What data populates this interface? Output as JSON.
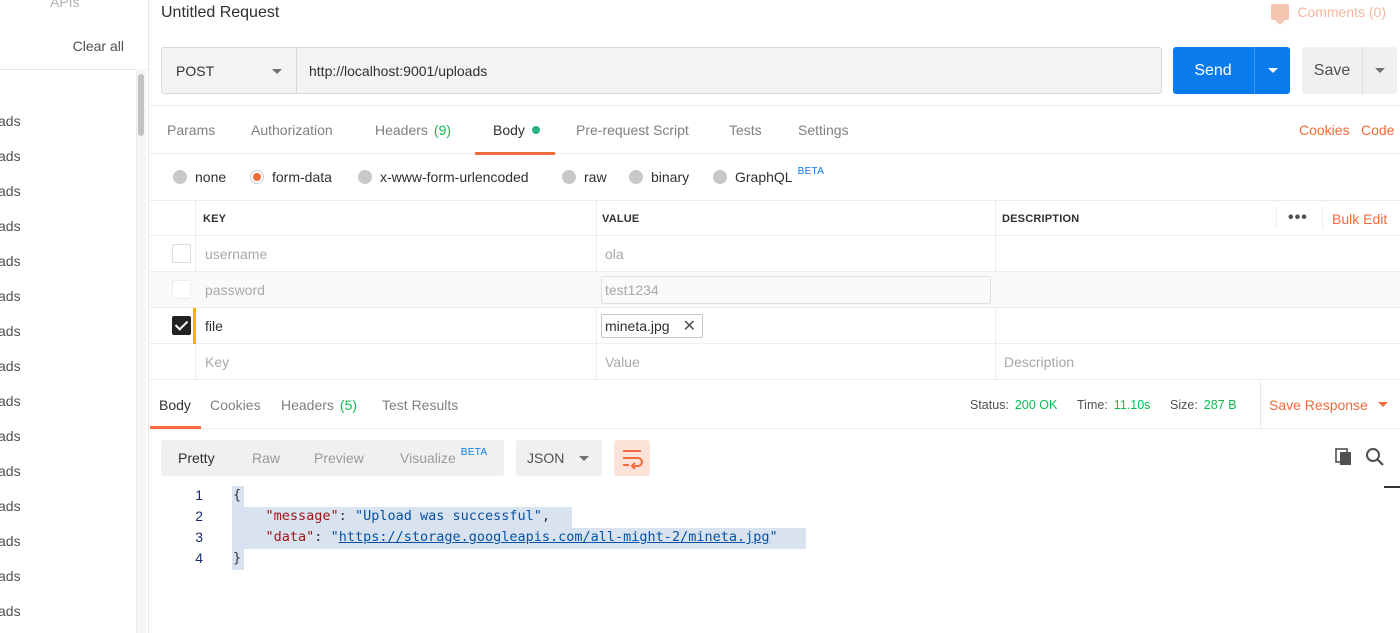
{
  "sidebar": {
    "apis_label": "APIs",
    "clear_all_label": "Clear all",
    "history_items": [
      "ads",
      "ads",
      "ads",
      "ads",
      "ads",
      "ads",
      "ads",
      "ads",
      "ads",
      "ads",
      "ads",
      "ads",
      "ads",
      "ads",
      "ads"
    ]
  },
  "request": {
    "title": "Untitled Request",
    "comments_label": "Comments (0)",
    "method": "POST",
    "url": "http://localhost:9001/uploads",
    "send_label": "Send",
    "save_label": "Save"
  },
  "request_tabs": {
    "params": "Params",
    "authorization": "Authorization",
    "headers": "Headers",
    "headers_count": "(9)",
    "body": "Body",
    "prerequest": "Pre-request Script",
    "tests": "Tests",
    "settings": "Settings",
    "cookies": "Cookies",
    "code": "Code"
  },
  "body_types": {
    "none": "none",
    "form_data": "form-data",
    "urlencoded": "x-www-form-urlencoded",
    "raw": "raw",
    "binary": "binary",
    "graphql": "GraphQL",
    "beta": "BETA",
    "selected": "form-data"
  },
  "params_table": {
    "headers": {
      "key": "KEY",
      "value": "VALUE",
      "description": "DESCRIPTION"
    },
    "more_label": "•••",
    "bulk_edit_label": "Bulk Edit",
    "rows": [
      {
        "key": "username",
        "value": "ola",
        "description": "",
        "checked": false
      },
      {
        "key": "password",
        "value": "test1234",
        "description": "",
        "checked": false
      },
      {
        "key": "file",
        "value": "mineta.jpg",
        "description": "",
        "checked": true
      }
    ],
    "placeholders": {
      "key": "Key",
      "value": "Value",
      "description": "Description"
    }
  },
  "response": {
    "tabs": {
      "body": "Body",
      "cookies": "Cookies",
      "headers": "Headers",
      "headers_count": "(5)",
      "test_results": "Test Results"
    },
    "status_label": "Status:",
    "status_value": "200 OK",
    "time_label": "Time:",
    "time_value": "11.10s",
    "size_label": "Size:",
    "size_value": "287 B",
    "save_response_label": "Save Response",
    "view_tabs": {
      "pretty": "Pretty",
      "raw": "Raw",
      "preview": "Preview",
      "visualize": "Visualize",
      "beta": "BETA"
    },
    "language": "JSON",
    "code_lines": [
      {
        "num": "1",
        "text": "{"
      },
      {
        "num": "2",
        "key": "\"message\"",
        "sep": ": ",
        "val": "\"Upload was successful\"",
        "end": ","
      },
      {
        "num": "3",
        "key": "\"data\"",
        "sep": ": ",
        "quote": "\"",
        "link": "https://storage.googleapis.com/all-might-2/mineta.jpg",
        "end": "\""
      },
      {
        "num": "4",
        "text": "}"
      }
    ]
  },
  "colors": {
    "accent": "#f26b3a",
    "send_blue": "#097bed",
    "success_green": "#0cbb52",
    "indicator_dot": "#26b47f"
  },
  "icons": [
    "comment-icon",
    "chevron-down-icon",
    "checkbox-checked-icon",
    "close-icon",
    "more-dots-icon",
    "wrap-lines-icon",
    "copy-icon",
    "search-icon"
  ]
}
